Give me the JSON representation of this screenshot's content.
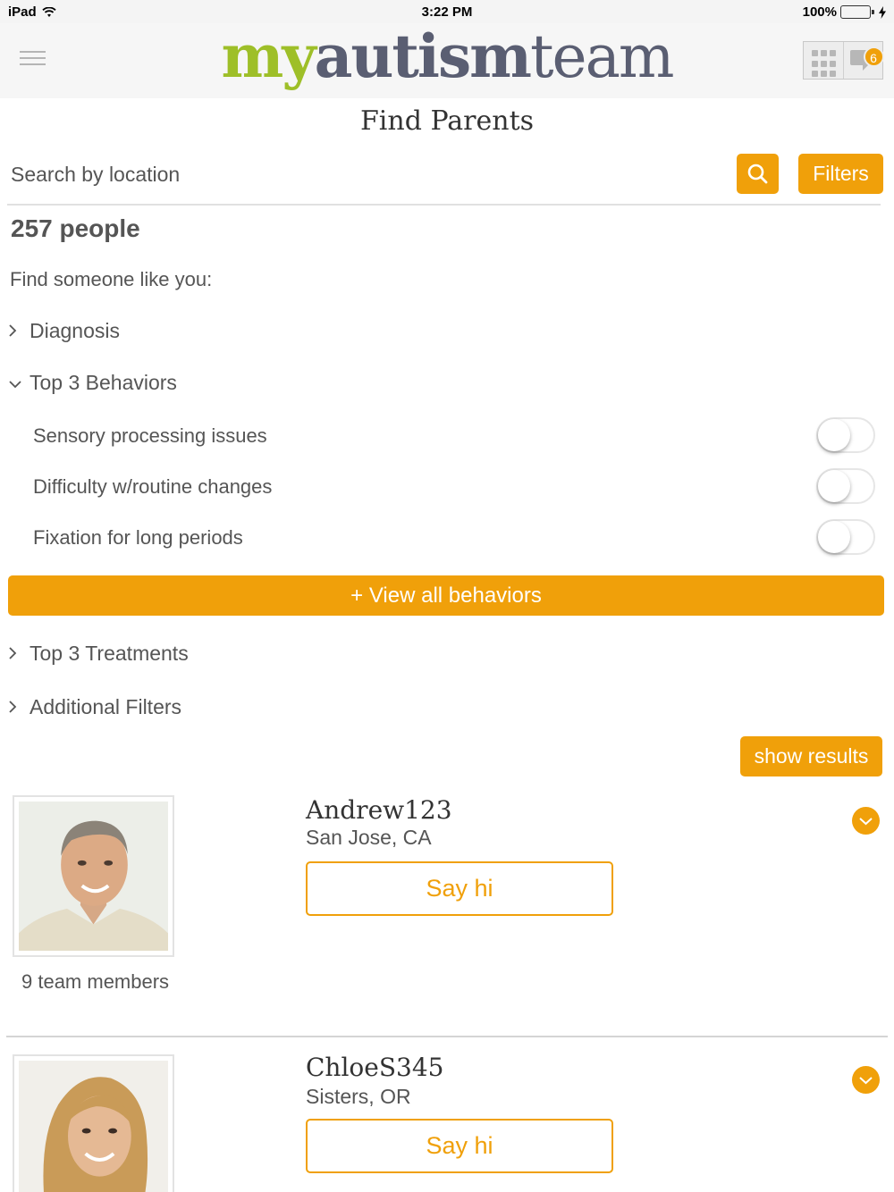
{
  "status_bar": {
    "carrier": "iPad",
    "time": "3:22 PM",
    "battery": "100%"
  },
  "header": {
    "logo": {
      "part1": "my",
      "part2": "autism",
      "part3": "team"
    },
    "message_badge": "6"
  },
  "page": {
    "title": "Find Parents"
  },
  "search": {
    "placeholder": "Search by location",
    "filters_label": "Filters"
  },
  "results": {
    "count_label": "257 people",
    "find_label": "Find someone like you:"
  },
  "filters": {
    "diagnosis": "Diagnosis",
    "behaviors": {
      "label": "Top 3 Behaviors",
      "items": [
        {
          "label": "Sensory processing issues",
          "on": false
        },
        {
          "label": "Difficulty w/routine changes",
          "on": false
        },
        {
          "label": "Fixation for long periods",
          "on": false
        }
      ],
      "view_all": "+ View all behaviors"
    },
    "treatments": "Top 3 Treatments",
    "additional": "Additional Filters",
    "show_results": "show results"
  },
  "members": [
    {
      "name": "Andrew123",
      "location": "San Jose, CA",
      "say_hi": "Say hi",
      "team": "9 team members"
    },
    {
      "name": "ChloeS345",
      "location": "Sisters, OR",
      "say_hi": "Say hi"
    }
  ],
  "colors": {
    "accent": "#f0a00a",
    "logo_green": "#9ebf28",
    "logo_slate": "#5a5e72"
  }
}
